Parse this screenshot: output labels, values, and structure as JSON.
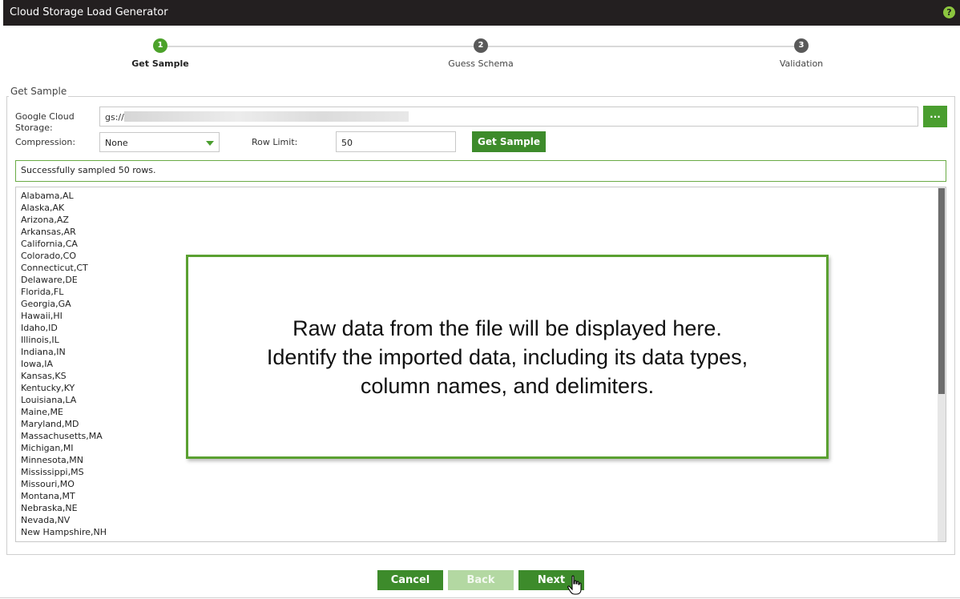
{
  "window": {
    "title": "Cloud Storage Load Generator",
    "help_icon": "help-icon"
  },
  "stepper": {
    "steps": [
      {
        "number": "1",
        "label": "Get Sample",
        "active": true
      },
      {
        "number": "2",
        "label": "Guess Schema",
        "active": false
      },
      {
        "number": "3",
        "label": "Validation",
        "active": false
      }
    ]
  },
  "form": {
    "legend": "Get Sample",
    "gcs_label": "Google Cloud Storage:",
    "gcs_value": "gs://",
    "browse_label": "...",
    "compression_label": "Compression:",
    "compression_value": "None",
    "row_limit_label": "Row Limit:",
    "row_limit_value": "50",
    "get_sample_label": "Get Sample",
    "status": "Successfully sampled 50 rows."
  },
  "data_preview": {
    "lines": [
      "Alabama,AL",
      "Alaska,AK",
      "Arizona,AZ",
      "Arkansas,AR",
      "California,CA",
      "Colorado,CO",
      "Connecticut,CT",
      "Delaware,DE",
      "Florida,FL",
      "Georgia,GA",
      "Hawaii,HI",
      "Idaho,ID",
      "Illinois,IL",
      "Indiana,IN",
      "Iowa,IA",
      "Kansas,KS",
      "Kentucky,KY",
      "Louisiana,LA",
      "Maine,ME",
      "Maryland,MD",
      "Massachusetts,MA",
      "Michigan,MI",
      "Minnesota,MN",
      "Mississippi,MS",
      "Missouri,MO",
      "Montana,MT",
      "Nebraska,NE",
      "Nevada,NV",
      "New Hampshire,NH"
    ]
  },
  "callout": {
    "lines": [
      "Raw data from the file will be displayed here.",
      "Identify the imported data, including its data types,",
      "column names, and delimiters."
    ]
  },
  "footer": {
    "cancel_label": "Cancel",
    "back_label": "Back",
    "next_label": "Next"
  },
  "colors": {
    "accent": "#3d8b2b",
    "active_step": "#4ca22a",
    "title_bar": "#231f20"
  }
}
